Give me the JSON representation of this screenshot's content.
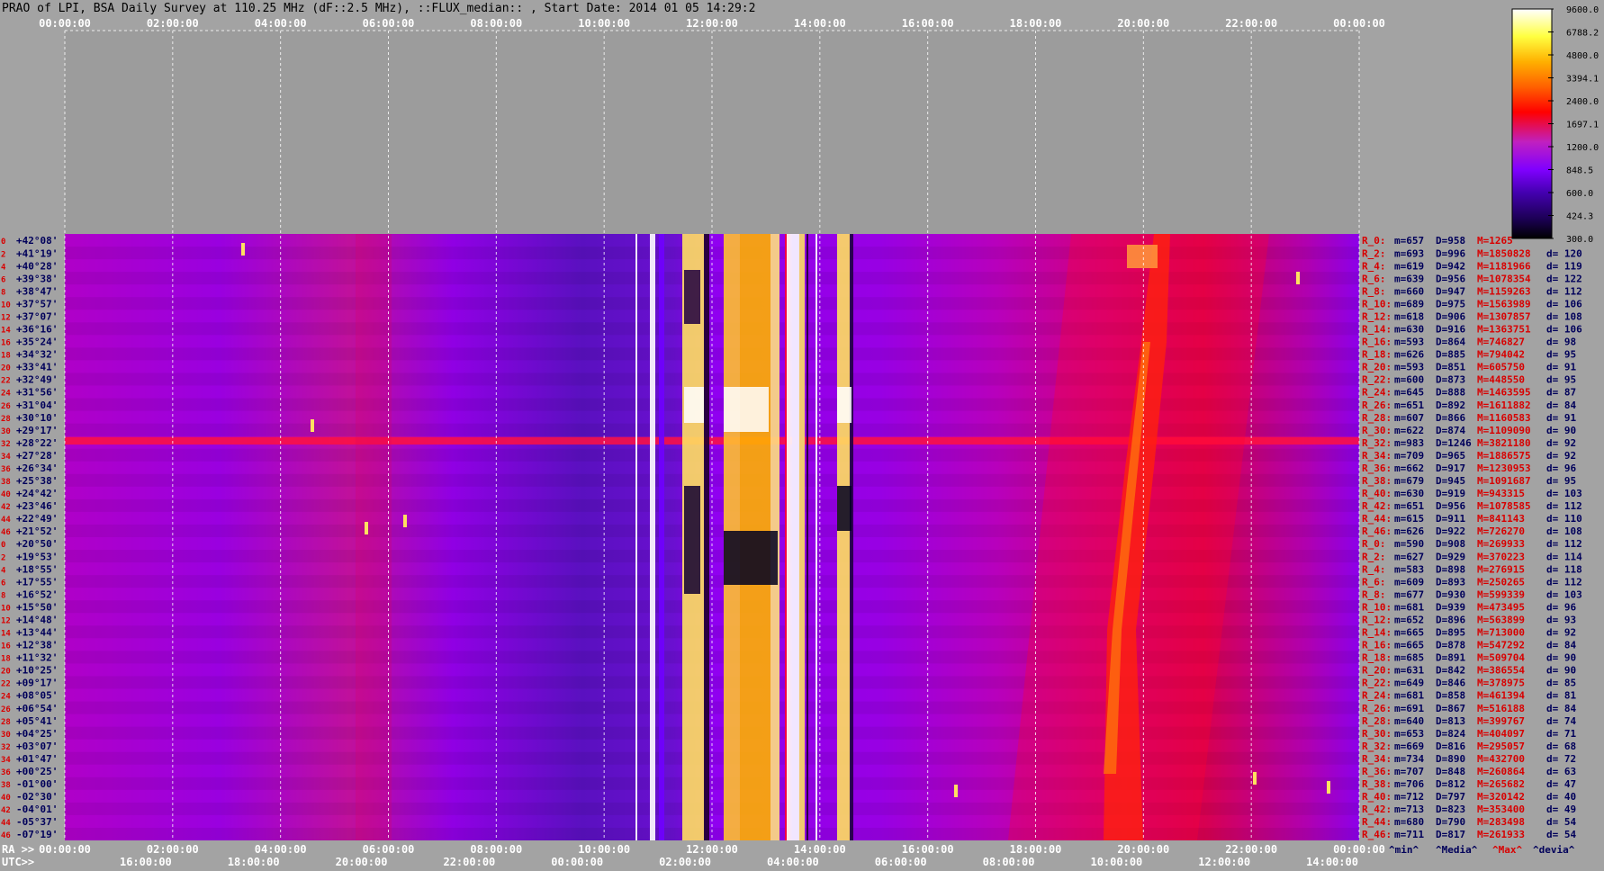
{
  "title": "PRAO of LPI, BSA Daily Survey at 110.25 MHz (dF::2.5 MHz), ::FLUX_median:: , Start Date: 2014 01 05 14:29:2",
  "top_axis": {
    "ticks": [
      "00:00:00",
      "02:00:00",
      "04:00:00",
      "06:00:00",
      "08:00:00",
      "10:00:00",
      "12:00:00",
      "14:00:00",
      "16:00:00",
      "18:00:00",
      "20:00:00",
      "22:00:00",
      "00:00:00"
    ]
  },
  "bottom_axis": {
    "ra_label": "RA >>",
    "ra_ticks": [
      "00:00:00",
      "02:00:00",
      "04:00:00",
      "06:00:00",
      "08:00:00",
      "10:00:00",
      "12:00:00",
      "14:00:00",
      "16:00:00",
      "18:00:00",
      "20:00:00",
      "22:00:00",
      "00:00:00"
    ],
    "utc_label": "UTC>>",
    "utc_ticks": [
      "16:00:00",
      "18:00:00",
      "20:00:00",
      "22:00:00",
      "00:00:00",
      "02:00:00",
      "04:00:00",
      "06:00:00",
      "08:00:00",
      "10:00:00",
      "12:00:00",
      "14:00:00"
    ]
  },
  "colorbar": {
    "ticks": [
      "9600.0",
      "6788.2",
      "4800.0",
      "3394.1",
      "2400.0",
      "1697.1",
      "1200.0",
      "848.5",
      "600.0",
      "424.3",
      "300.0"
    ]
  },
  "chart_data": {
    "type": "heatmap",
    "title": "PRAO of LPI, BSA Daily Survey at 110.25 MHz (dF::2.5 MHz), ::FLUX_median:: , Start Date: 2014 01 05 14:29:2",
    "x_axis_top": "RA 00:00:00 - 24:00:00",
    "color_scale": [
      300.0,
      9600.0
    ],
    "row_labels": [
      {
        "n": "0",
        "dec": "+42°08'"
      },
      {
        "n": "2",
        "dec": "+41°19'"
      },
      {
        "n": "4",
        "dec": "+40°28'"
      },
      {
        "n": "6",
        "dec": "+39°38'"
      },
      {
        "n": "8",
        "dec": "+38°47'"
      },
      {
        "n": "10",
        "dec": "+37°57'"
      },
      {
        "n": "12",
        "dec": "+37°07'"
      },
      {
        "n": "14",
        "dec": "+36°16'"
      },
      {
        "n": "16",
        "dec": "+35°24'"
      },
      {
        "n": "18",
        "dec": "+34°32'"
      },
      {
        "n": "20",
        "dec": "+33°41'"
      },
      {
        "n": "22",
        "dec": "+32°49'"
      },
      {
        "n": "24",
        "dec": "+31°56'"
      },
      {
        "n": "26",
        "dec": "+31°04'"
      },
      {
        "n": "28",
        "dec": "+30°10'"
      },
      {
        "n": "30",
        "dec": "+29°17'"
      },
      {
        "n": "32",
        "dec": "+28°22'"
      },
      {
        "n": "34",
        "dec": "+27°28'"
      },
      {
        "n": "36",
        "dec": "+26°34'"
      },
      {
        "n": "38",
        "dec": "+25°38'"
      },
      {
        "n": "40",
        "dec": "+24°42'"
      },
      {
        "n": "42",
        "dec": "+23°46'"
      },
      {
        "n": "44",
        "dec": "+22°49'"
      },
      {
        "n": "46",
        "dec": "+21°52'"
      },
      {
        "n": "0",
        "dec": "+20°50'"
      },
      {
        "n": "2",
        "dec": "+19°53'"
      },
      {
        "n": "4",
        "dec": "+18°55'"
      },
      {
        "n": "6",
        "dec": "+17°55'"
      },
      {
        "n": "8",
        "dec": "+16°52'"
      },
      {
        "n": "10",
        "dec": "+15°50'"
      },
      {
        "n": "12",
        "dec": "+14°48'"
      },
      {
        "n": "14",
        "dec": "+13°44'"
      },
      {
        "n": "16",
        "dec": "+12°38'"
      },
      {
        "n": "18",
        "dec": "+11°32'"
      },
      {
        "n": "20",
        "dec": "+10°25'"
      },
      {
        "n": "22",
        "dec": "+09°17'"
      },
      {
        "n": "24",
        "dec": "+08°05'"
      },
      {
        "n": "26",
        "dec": "+06°54'"
      },
      {
        "n": "28",
        "dec": "+05°41'"
      },
      {
        "n": "30",
        "dec": "+04°25'"
      },
      {
        "n": "32",
        "dec": "+03°07'"
      },
      {
        "n": "34",
        "dec": "+01°47'"
      },
      {
        "n": "36",
        "dec": "+00°25'"
      },
      {
        "n": "38",
        "dec": "-01°00'"
      },
      {
        "n": "40",
        "dec": "-02°30'"
      },
      {
        "n": "42",
        "dec": "-04°01'"
      },
      {
        "n": "44",
        "dec": "-05°37'"
      },
      {
        "n": "46",
        "dec": "-07°19'"
      }
    ],
    "row_stats": [
      {
        "r": "R_0:",
        "m": "m=657",
        "D": "D=958",
        "M": "M=1265",
        "d": ""
      },
      {
        "r": "R_2:",
        "m": "m=693",
        "D": "D=996",
        "M": "M=1850828",
        "d": "d= 120"
      },
      {
        "r": "R_4:",
        "m": "m=619",
        "D": "D=942",
        "M": "M=1181966",
        "d": "d= 119"
      },
      {
        "r": "R_6:",
        "m": "m=639",
        "D": "D=956",
        "M": "M=1078354",
        "d": "d= 122"
      },
      {
        "r": "R_8:",
        "m": "m=660",
        "D": "D=947",
        "M": "M=1159263",
        "d": "d= 112"
      },
      {
        "r": "R_10:",
        "m": "m=689",
        "D": "D=975",
        "M": "M=1563989",
        "d": "d= 106"
      },
      {
        "r": "R_12:",
        "m": "m=618",
        "D": "D=906",
        "M": "M=1307857",
        "d": "d= 108"
      },
      {
        "r": "R_14:",
        "m": "m=630",
        "D": "D=916",
        "M": "M=1363751",
        "d": "d= 106"
      },
      {
        "r": "R_16:",
        "m": "m=593",
        "D": "D=864",
        "M": "M=746827",
        "d": "d= 98"
      },
      {
        "r": "R_18:",
        "m": "m=626",
        "D": "D=885",
        "M": "M=794042",
        "d": "d= 95"
      },
      {
        "r": "R_20:",
        "m": "m=593",
        "D": "D=851",
        "M": "M=605750",
        "d": "d= 91"
      },
      {
        "r": "R_22:",
        "m": "m=600",
        "D": "D=873",
        "M": "M=448550",
        "d": "d= 95"
      },
      {
        "r": "R_24:",
        "m": "m=645",
        "D": "D=888",
        "M": "M=1463595",
        "d": "d= 87"
      },
      {
        "r": "R_26:",
        "m": "m=651",
        "D": "D=892",
        "M": "M=1611882",
        "d": "d= 84"
      },
      {
        "r": "R_28:",
        "m": "m=607",
        "D": "D=866",
        "M": "M=1160583",
        "d": "d= 91"
      },
      {
        "r": "R_30:",
        "m": "m=622",
        "D": "D=874",
        "M": "M=1109090",
        "d": "d= 90"
      },
      {
        "r": "R_32:",
        "m": "m=983",
        "D": "D=1246",
        "M": "M=3821180",
        "d": "d= 92"
      },
      {
        "r": "R_34:",
        "m": "m=709",
        "D": "D=965",
        "M": "M=1886575",
        "d": "d= 92"
      },
      {
        "r": "R_36:",
        "m": "m=662",
        "D": "D=917",
        "M": "M=1230953",
        "d": "d= 96"
      },
      {
        "r": "R_38:",
        "m": "m=679",
        "D": "D=945",
        "M": "M=1091687",
        "d": "d= 95"
      },
      {
        "r": "R_40:",
        "m": "m=630",
        "D": "D=919",
        "M": "M=943315",
        "d": "d= 103"
      },
      {
        "r": "R_42:",
        "m": "m=651",
        "D": "D=956",
        "M": "M=1078585",
        "d": "d= 112"
      },
      {
        "r": "R_44:",
        "m": "m=615",
        "D": "D=911",
        "M": "M=841143",
        "d": "d= 110"
      },
      {
        "r": "R_46:",
        "m": "m=626",
        "D": "D=922",
        "M": "M=726270",
        "d": "d= 108"
      },
      {
        "r": "R_0:",
        "m": "m=590",
        "D": "D=908",
        "M": "M=269933",
        "d": "d= 112"
      },
      {
        "r": "R_2:",
        "m": "m=627",
        "D": "D=929",
        "M": "M=370223",
        "d": "d= 114"
      },
      {
        "r": "R_4:",
        "m": "m=583",
        "D": "D=898",
        "M": "M=276915",
        "d": "d= 118"
      },
      {
        "r": "R_6:",
        "m": "m=609",
        "D": "D=893",
        "M": "M=250265",
        "d": "d= 112"
      },
      {
        "r": "R_8:",
        "m": "m=677",
        "D": "D=930",
        "M": "M=599339",
        "d": "d= 103"
      },
      {
        "r": "R_10:",
        "m": "m=681",
        "D": "D=939",
        "M": "M=473495",
        "d": "d= 96"
      },
      {
        "r": "R_12:",
        "m": "m=652",
        "D": "D=896",
        "M": "M=563899",
        "d": "d= 93"
      },
      {
        "r": "R_14:",
        "m": "m=665",
        "D": "D=895",
        "M": "M=713000",
        "d": "d= 92"
      },
      {
        "r": "R_16:",
        "m": "m=665",
        "D": "D=878",
        "M": "M=547292",
        "d": "d= 84"
      },
      {
        "r": "R_18:",
        "m": "m=685",
        "D": "D=891",
        "M": "M=509704",
        "d": "d= 90"
      },
      {
        "r": "R_20:",
        "m": "m=631",
        "D": "D=842",
        "M": "M=386554",
        "d": "d= 90"
      },
      {
        "r": "R_22:",
        "m": "m=649",
        "D": "D=846",
        "M": "M=378975",
        "d": "d= 85"
      },
      {
        "r": "R_24:",
        "m": "m=681",
        "D": "D=858",
        "M": "M=461394",
        "d": "d= 81"
      },
      {
        "r": "R_26:",
        "m": "m=691",
        "D": "D=867",
        "M": "M=516188",
        "d": "d= 84"
      },
      {
        "r": "R_28:",
        "m": "m=640",
        "D": "D=813",
        "M": "M=399767",
        "d": "d= 74"
      },
      {
        "r": "R_30:",
        "m": "m=653",
        "D": "D=824",
        "M": "M=404097",
        "d": "d= 71"
      },
      {
        "r": "R_32:",
        "m": "m=669",
        "D": "D=816",
        "M": "M=295057",
        "d": "d= 68"
      },
      {
        "r": "R_34:",
        "m": "m=734",
        "D": "D=890",
        "M": "M=432700",
        "d": "d= 72"
      },
      {
        "r": "R_36:",
        "m": "m=707",
        "D": "D=848",
        "M": "M=260864",
        "d": "d= 63"
      },
      {
        "r": "R_38:",
        "m": "m=706",
        "D": "D=812",
        "M": "M=265682",
        "d": "d= 47"
      },
      {
        "r": "R_40:",
        "m": "m=712",
        "D": "D=797",
        "M": "M=320142",
        "d": "d= 40"
      },
      {
        "r": "R_42:",
        "m": "m=713",
        "D": "D=823",
        "M": "M=353400",
        "d": "d= 49"
      },
      {
        "r": "R_44:",
        "m": "m=680",
        "D": "D=790",
        "M": "M=283498",
        "d": "d= 54"
      },
      {
        "r": "R_46:",
        "m": "m=711",
        "D": "D=817",
        "M": "M=261933",
        "d": "d= 54"
      }
    ],
    "stats_footer": [
      "^min^",
      "^Media^",
      "^Max^",
      "^devia^"
    ]
  },
  "colors": {
    "background": "#a3a3a3",
    "label_red": "#d80000",
    "label_navy": "#00005a",
    "grid": "#ffffff",
    "colormap": [
      "#000000",
      "#1a0050",
      "#4400b0",
      "#8000ff",
      "#c020c0",
      "#ff0000",
      "#ff6000",
      "#ffb000",
      "#ffff40",
      "#ffffff"
    ]
  }
}
